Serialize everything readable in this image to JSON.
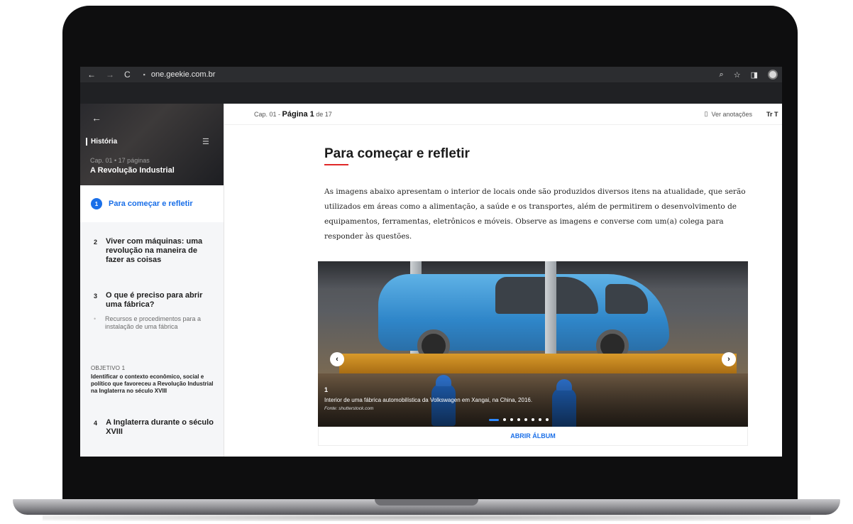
{
  "browser": {
    "back": "←",
    "forward": "→",
    "reload": "C",
    "lock": "🔒",
    "url": "one.geekie.com.br",
    "zoom_icon": "⌕",
    "star_icon": "☆",
    "panel_icon": "◨"
  },
  "sidebar": {
    "back": "←",
    "subject": "História",
    "menu_icon": "☰",
    "chapter_meta": "Cap. 01 • 17 páginas",
    "chapter_title": "A Revolução Industrial",
    "active_item": {
      "number": "1",
      "label": "Para começar e refletir"
    },
    "items": [
      {
        "number": "2",
        "label": "Viver com máquinas: uma revolução na maneira de fazer as coisas"
      },
      {
        "number": "3",
        "label": "O que é preciso para abrir uma fábrica?"
      },
      {
        "number": "4",
        "label": "A Inglaterra durante o século XVIII"
      }
    ],
    "subitem": "Recursos e procedimentos para a instalação de uma fábrica",
    "objective_label": "OBJETIVO 1",
    "objective_text": "Identificar o contexto econômico, social e político que favoreceu a Revolução Industrial na Inglaterra no século XVIII"
  },
  "topbar": {
    "crumb_prefix": "Cap. 01 - ",
    "page_label": "Página 1",
    "page_suffix": " de 17",
    "notes": "Ver anotações",
    "bookmark_icon": "🔖",
    "text_size": "Tr T"
  },
  "content": {
    "title": "Para começar e refletir",
    "paragraph": "As imagens abaixo apresentam o interior de locais onde são produzidos diversos itens na atualidade, que serão utilizados em áreas como a alimentação, a saúde e os transportes, além de permitirem o desenvolvimento de equipamentos, ferramentas, eletrônicos e móveis. Observe as imagens e converse com um(a) colega para responder às questões."
  },
  "carousel": {
    "prev": "‹",
    "next": "›",
    "slide_number": "1",
    "caption": "Interior de uma fábrica automobilística da Volkswagen em Xangai, na China, 2016.",
    "source": "Fonte: shutterstock.com",
    "slide_count": 8,
    "active_slide": 1,
    "open_album": "ABRIR ÁLBUM"
  },
  "colors": {
    "accent": "#1a6fe8",
    "title_underline": "#e02828"
  }
}
